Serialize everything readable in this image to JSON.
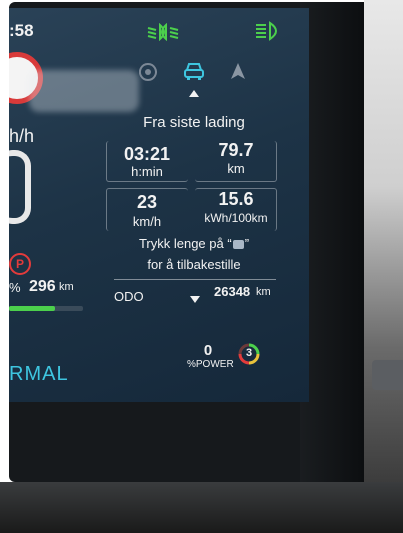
{
  "status_bar": {
    "time_fragment": ":58",
    "low_beam_icon": "low-beam-headlight-icon",
    "high_beam_icon": "high-beam-headlight-icon",
    "indicator_color": "#4cd04c"
  },
  "left_panel": {
    "speed_unit_fragment": "h/h",
    "parking_label": "P",
    "range_prefix": "%",
    "range_value": "296",
    "range_unit": "km",
    "mode_fragment": "RMAL"
  },
  "tabs": [
    {
      "icon": "tire-pressure-icon"
    },
    {
      "icon": "car-icon",
      "active": true
    },
    {
      "icon": "navigation-arrow-icon"
    }
  ],
  "trip": {
    "title": "Fra siste lading",
    "stats": [
      {
        "value": "03:21",
        "unit": "h:min"
      },
      {
        "value": "79.7",
        "unit": "km"
      },
      {
        "value": "23",
        "unit": "km/h"
      },
      {
        "value": "15.6",
        "unit": "kWh/100km"
      }
    ],
    "reset_hint_line1": "Trykk lenge på “",
    "reset_hint_close": "”",
    "reset_hint_line2": "for å tilbakestille",
    "odo_label": "ODO",
    "odo_value": "26348",
    "odo_unit": "km"
  },
  "power": {
    "value": "0",
    "label": "%POWER",
    "regen_level": "3"
  },
  "colors": {
    "accent_green": "#4cd04c",
    "accent_cyan": "#3ec6e0",
    "parking_red": "#e23b3b"
  }
}
